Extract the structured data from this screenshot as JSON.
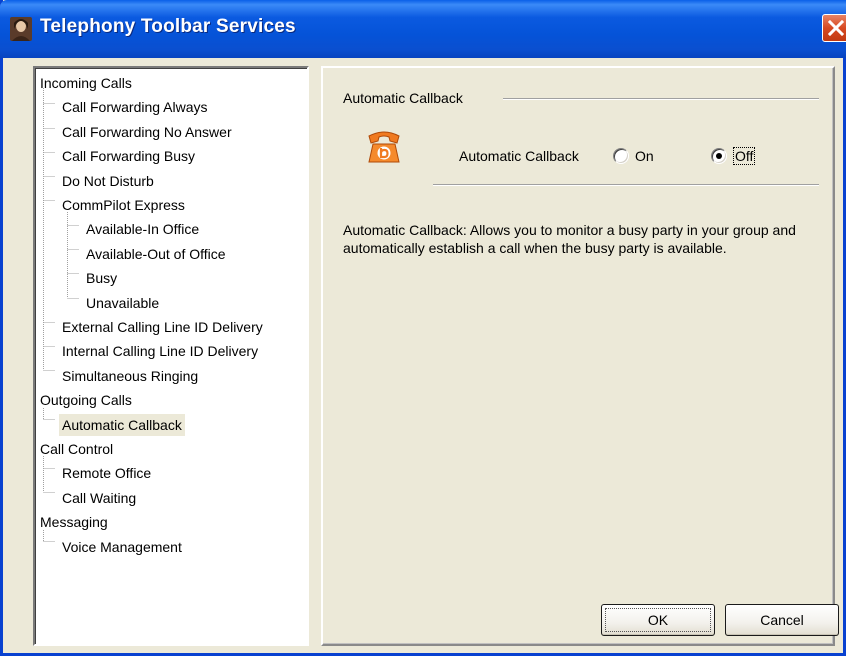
{
  "window": {
    "title": "Telephony Toolbar Services",
    "icons": {
      "app": "person-portrait-icon",
      "close": "close-x-icon"
    }
  },
  "tree": {
    "nodes": [
      {
        "label": "Incoming Calls",
        "level": 0
      },
      {
        "label": "Call Forwarding Always",
        "level": 1
      },
      {
        "label": "Call Forwarding No Answer",
        "level": 1
      },
      {
        "label": "Call Forwarding Busy",
        "level": 1
      },
      {
        "label": "Do Not Disturb",
        "level": 1
      },
      {
        "label": "CommPilot Express",
        "level": 1
      },
      {
        "label": "Available-In Office",
        "level": 2
      },
      {
        "label": "Available-Out of Office",
        "level": 2
      },
      {
        "label": "Busy",
        "level": 2
      },
      {
        "label": "Unavailable",
        "level": 2
      },
      {
        "label": "External Calling Line ID Delivery",
        "level": 1
      },
      {
        "label": "Internal Calling Line ID Delivery",
        "level": 1
      },
      {
        "label": "Simultaneous Ringing",
        "level": 1
      },
      {
        "label": "Outgoing Calls",
        "level": 0
      },
      {
        "label": "Automatic Callback",
        "level": 1,
        "selected": true
      },
      {
        "label": "Call Control",
        "level": 0
      },
      {
        "label": "Remote Office",
        "level": 1
      },
      {
        "label": "Call Waiting",
        "level": 1
      },
      {
        "label": "Messaging",
        "level": 0
      },
      {
        "label": "Voice Management",
        "level": 1
      }
    ]
  },
  "panel": {
    "group_title": "Automatic Callback",
    "icon": "orange-telephone-callback-icon",
    "field_label": "Automatic Callback",
    "options": [
      "On",
      "Off"
    ],
    "selected": "Off",
    "description": "Automatic Callback: Allows you to monitor a busy party in your group and automatically establish a call when the busy party is available."
  },
  "buttons": {
    "ok": "OK",
    "cancel": "Cancel"
  },
  "colors": {
    "titlebar": "#0553d8",
    "face": "#ece9d8",
    "accent_icon": "#f07a20"
  }
}
